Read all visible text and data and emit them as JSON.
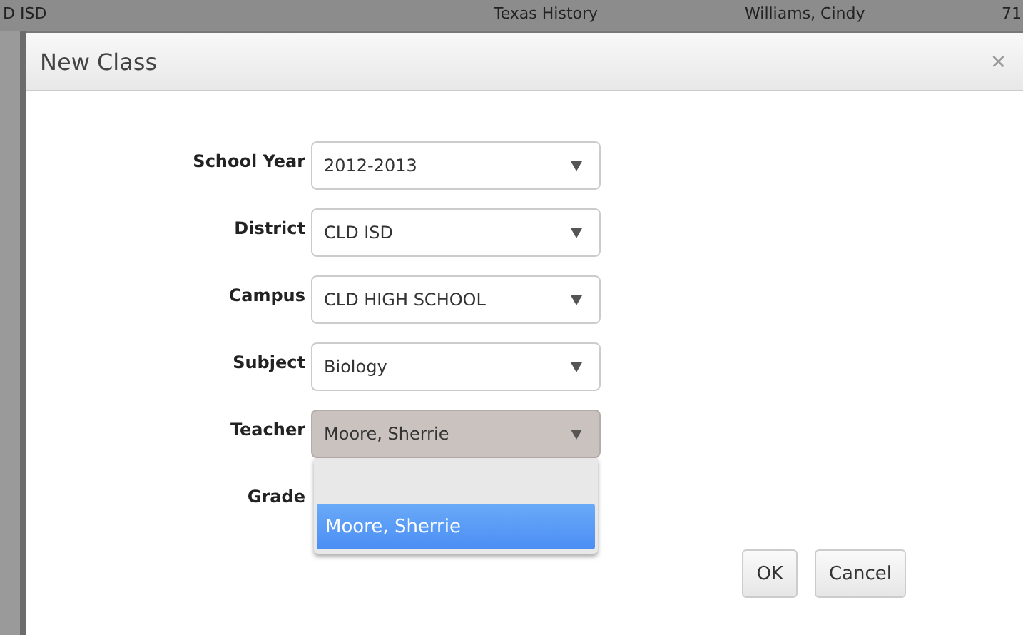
{
  "background_row": [
    "D ISD",
    "Texas History",
    "Williams, Cindy",
    "71"
  ],
  "dialog": {
    "title": "New Class",
    "close": "×",
    "fields": [
      {
        "label": "School Year",
        "value": "2012-2013",
        "expanded": false
      },
      {
        "label": "District",
        "value": "CLD ISD",
        "expanded": false
      },
      {
        "label": "Campus",
        "value": "CLD HIGH SCHOOL",
        "expanded": false
      },
      {
        "label": "Subject",
        "value": "Biology",
        "expanded": false
      },
      {
        "label": "Teacher",
        "value": "Moore, Sherrie",
        "expanded": true,
        "options": [
          {
            "selected": false
          },
          {
            "label": "Moore, Sherrie",
            "selected": true
          }
        ]
      },
      {
        "label": "Grade"
      }
    ],
    "buttons": [
      "OK",
      "Cancel"
    ]
  }
}
